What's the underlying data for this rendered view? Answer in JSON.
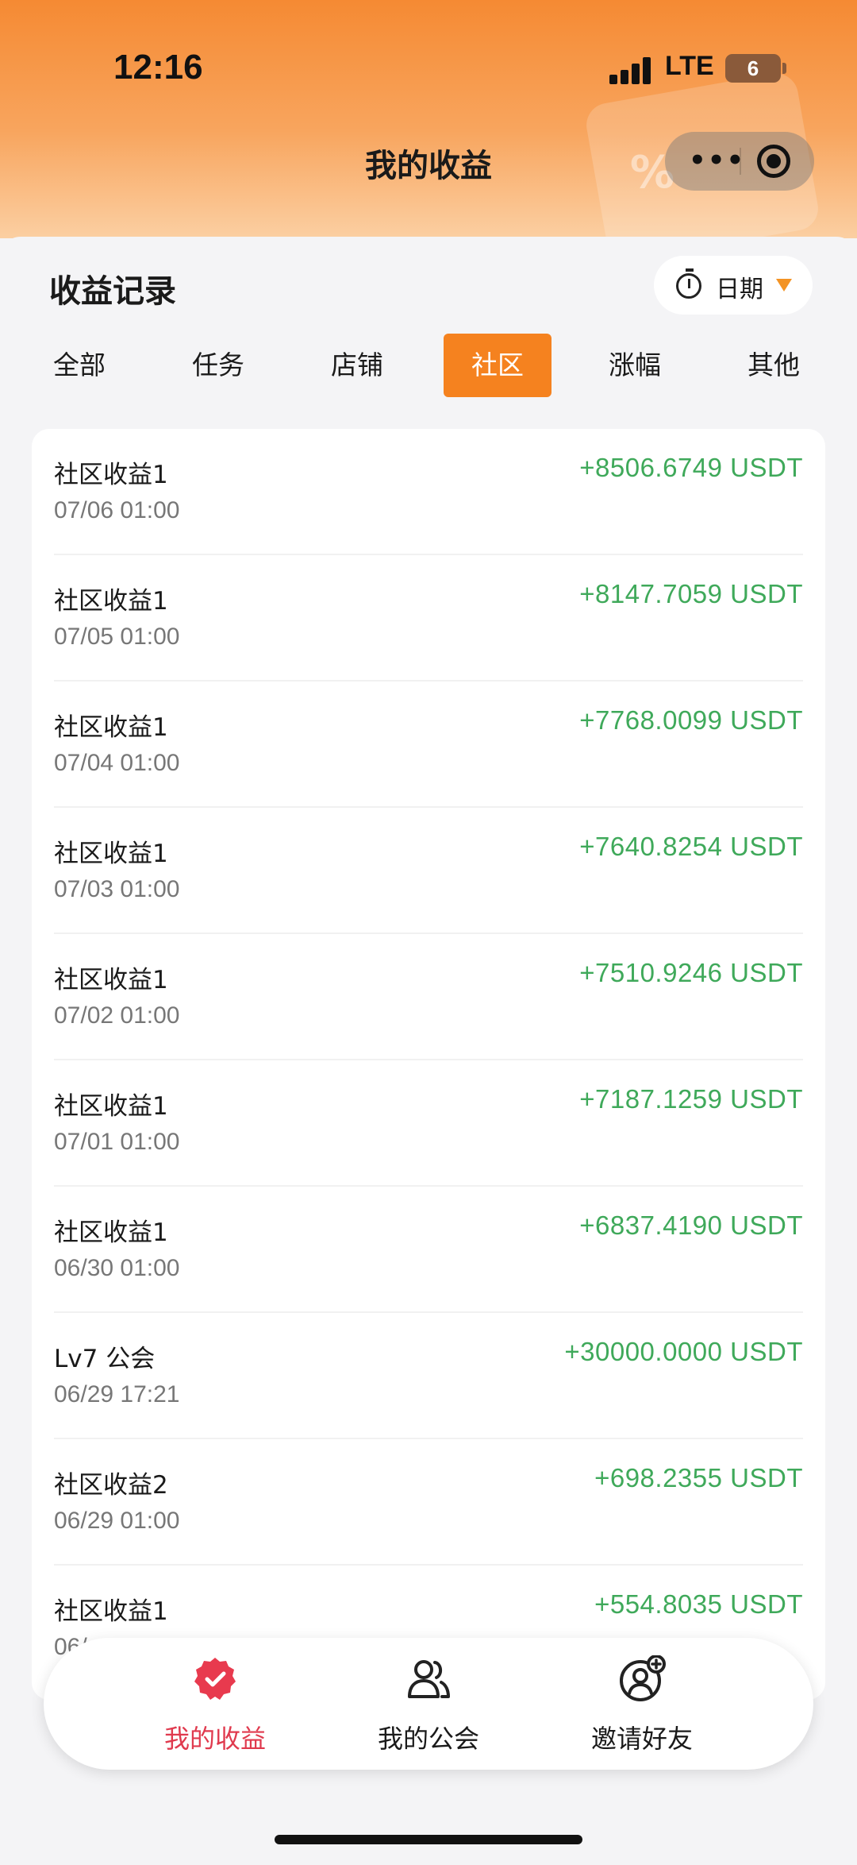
{
  "status_bar": {
    "time": "12:16",
    "network": "LTE",
    "battery": "6"
  },
  "nav": {
    "title": "我的收益",
    "more_icon": "more-dots-icon",
    "close_icon": "target-close-icon"
  },
  "section": {
    "title": "收益记录",
    "date_filter_label": "日期"
  },
  "tabs": [
    {
      "label": "全部",
      "active": false
    },
    {
      "label": "任务",
      "active": false
    },
    {
      "label": "店铺",
      "active": false
    },
    {
      "label": "社区",
      "active": true
    },
    {
      "label": "涨幅",
      "active": false
    },
    {
      "label": "其他",
      "active": false
    }
  ],
  "records": [
    {
      "title": "社区收益1",
      "time": "07/06 01:00",
      "amount": "+8506.6749 USDT"
    },
    {
      "title": "社区收益1",
      "time": "07/05 01:00",
      "amount": "+8147.7059 USDT"
    },
    {
      "title": "社区收益1",
      "time": "07/04 01:00",
      "amount": "+7768.0099 USDT"
    },
    {
      "title": "社区收益1",
      "time": "07/03 01:00",
      "amount": "+7640.8254 USDT"
    },
    {
      "title": "社区收益1",
      "time": "07/02 01:00",
      "amount": "+7510.9246 USDT"
    },
    {
      "title": "社区收益1",
      "time": "07/01 01:00",
      "amount": "+7187.1259 USDT"
    },
    {
      "title": "社区收益1",
      "time": "06/30 01:00",
      "amount": "+6837.4190 USDT"
    },
    {
      "title": "Lv7 公会",
      "time": "06/29 17:21",
      "amount": "+30000.0000 USDT"
    },
    {
      "title": "社区收益2",
      "time": "06/29 01:00",
      "amount": "+698.2355 USDT"
    },
    {
      "title": "社区收益1",
      "time": "06/",
      "amount": "+554.8035 USDT"
    }
  ],
  "bottom_nav": [
    {
      "label": "我的收益",
      "icon": "badge-check-icon",
      "active": true
    },
    {
      "label": "我的公会",
      "icon": "group-users-icon",
      "active": false
    },
    {
      "label": "邀请好友",
      "icon": "add-friend-icon",
      "active": false
    }
  ],
  "colors": {
    "accent": "#f5821f",
    "positive": "#3fa95a",
    "active_nav": "#e03a4e"
  }
}
